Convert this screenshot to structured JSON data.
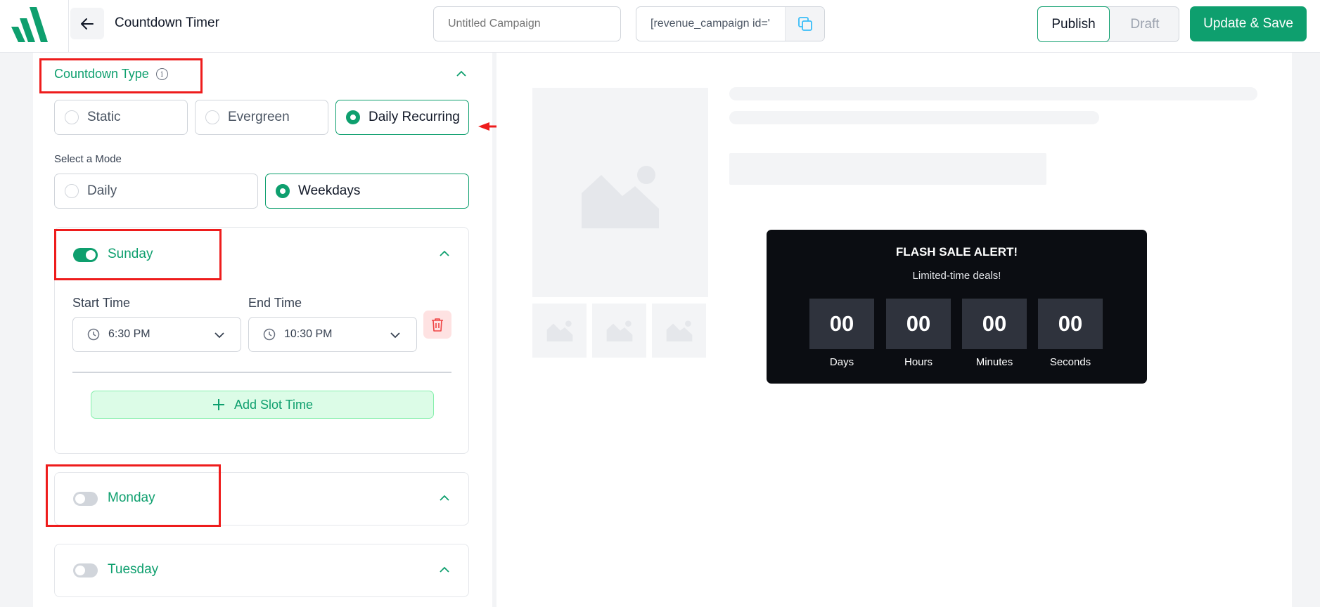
{
  "header": {
    "title": "Countdown Timer",
    "campaign_name_placeholder": "Untitled Campaign",
    "shortcode": "[revenue_campaign id='",
    "status_publish": "Publish",
    "status_draft": "Draft",
    "save_label": "Update & Save"
  },
  "countdown_type": {
    "title": "Countdown Type",
    "options": [
      "Static",
      "Evergreen",
      "Daily Recurring"
    ],
    "selected": "Daily Recurring"
  },
  "mode": {
    "label": "Select a Mode",
    "options": [
      "Daily",
      "Weekdays"
    ],
    "selected": "Weekdays"
  },
  "days": [
    {
      "name": "Sunday",
      "enabled": true,
      "start_label": "Start Time",
      "end_label": "End Time",
      "start_time": "6:30 PM",
      "end_time": "10:30 PM",
      "add_slot_label": "Add Slot Time"
    },
    {
      "name": "Monday",
      "enabled": false
    },
    {
      "name": "Tuesday",
      "enabled": false
    }
  ],
  "preview": {
    "timer_title": "FLASH SALE ALERT!",
    "timer_subtitle": "Limited-time deals!",
    "units": [
      {
        "value": "00",
        "label": "Days"
      },
      {
        "value": "00",
        "label": "Hours"
      },
      {
        "value": "00",
        "label": "Minutes"
      },
      {
        "value": "00",
        "label": "Seconds"
      }
    ]
  },
  "colors": {
    "brand_green": "#0e9f6e",
    "annotation_red": "#ee1c1c",
    "timer_bg": "#0b0d12",
    "timer_box": "#2f333d"
  }
}
